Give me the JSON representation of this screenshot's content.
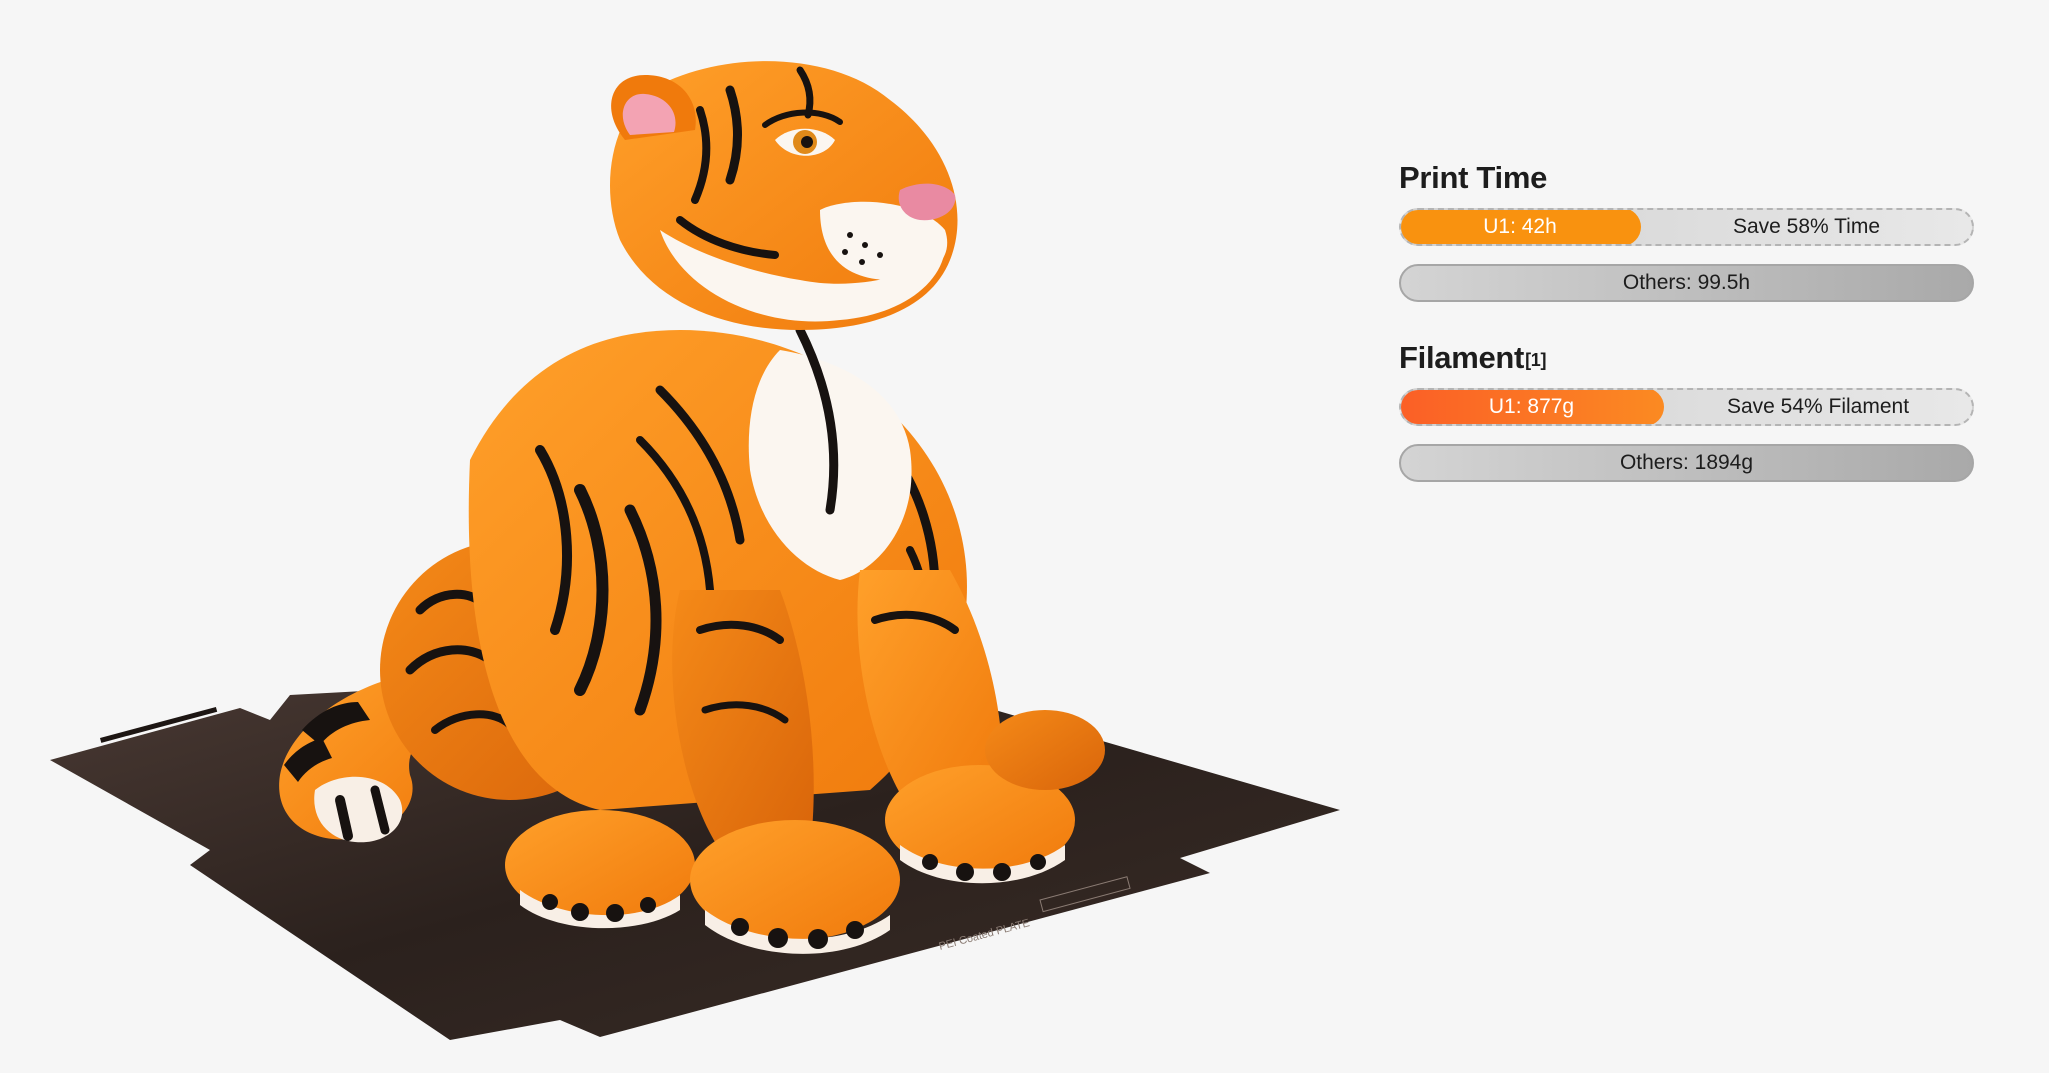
{
  "image": {
    "description_icon": "tiger-figure-icon",
    "plate_text": "PEI Coated PLATE"
  },
  "print_time": {
    "title": "Print Time",
    "u1_label": "U1: 42h",
    "u1_fraction": 0.42,
    "save_label": "Save 58% Time",
    "others_label": "Others: 99.5h"
  },
  "filament": {
    "title": "Filament",
    "footnote": "[1]",
    "u1_label": "U1: 877g",
    "u1_fraction": 0.46,
    "save_label": "Save 54% Filament",
    "others_label": "Others: 1894g"
  },
  "colors": {
    "time_accent": "#f9920f",
    "filament_accent": "#fb6a24",
    "background": "#f6f6f6"
  }
}
